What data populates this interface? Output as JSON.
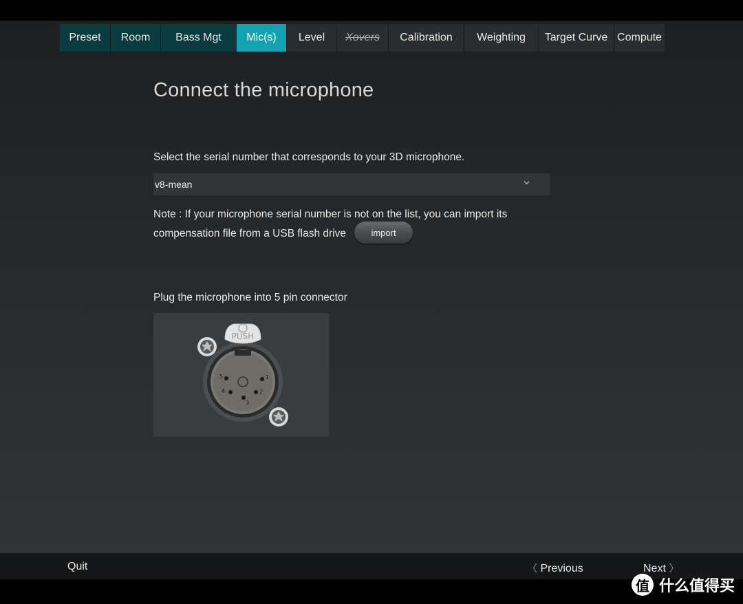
{
  "tabs": [
    {
      "label": "Preset",
      "state": "done"
    },
    {
      "label": "Room",
      "state": "done"
    },
    {
      "label": "Bass Mgt",
      "state": "done"
    },
    {
      "label": "Mic(s)",
      "state": "active"
    },
    {
      "label": "Level",
      "state": "pending"
    },
    {
      "label": "Xovers",
      "state": "disabled"
    },
    {
      "label": "Calibration",
      "state": "pending"
    },
    {
      "label": "Weighting",
      "state": "pending"
    },
    {
      "label": "Target Curve",
      "state": "pending"
    },
    {
      "label": "Compute",
      "state": "pending"
    }
  ],
  "page": {
    "title": "Connect the microphone",
    "select_prompt": "Select the serial number that corresponds to your 3D microphone.",
    "selected_serial": "v8-mean",
    "note_text": "Note : If your microphone serial number is not on the list, you can import its compensation file from a USB flash drive",
    "import_label": "import",
    "plug_label": "Plug the microphone into 5 pin connector",
    "connector": {
      "push_label": "PUSH",
      "pins": [
        "1",
        "2",
        "3",
        "4",
        "5"
      ]
    }
  },
  "footer": {
    "quit_label": "Quit",
    "previous_label": "Previous",
    "next_label": "Next"
  },
  "watermark": {
    "icon_text": "值",
    "text": "什么值得买"
  },
  "colors": {
    "active_tab": "#12a3b3",
    "done_tab": "#0a3b3f",
    "pending_tab": "#2a2c2e"
  }
}
